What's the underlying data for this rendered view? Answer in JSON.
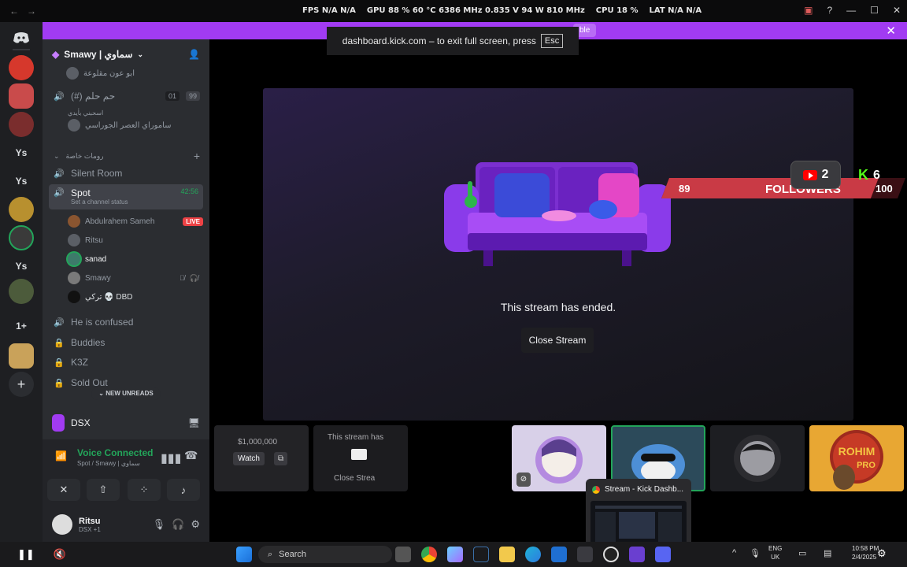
{
  "overlay_stats": {
    "fps": "FPS  N/A  N/A",
    "gpu": "GPU 88 % 60 °C 6386 MHz 0.835 V 94 W 810 MHz",
    "cpu": "CPU  18 %",
    "lat": "LAT  N/A  N/A"
  },
  "banner": {
    "pill_label": "ble",
    "close_icon": "close-icon"
  },
  "fullscreen_toast": {
    "text": "dashboard.kick.com – to exit full screen, press",
    "key": "Esc"
  },
  "rail": {
    "app_icon": "discord-logo-icon",
    "items": [
      "Ys",
      "Ys",
      "Ys",
      "1+"
    ],
    "add_label": "+"
  },
  "guild": {
    "name": "Smawy | سماوي"
  },
  "channels": {
    "top_item": "ابو عون مقلوعة",
    "voice_1": "(#) حم حلم",
    "voice_1_counts": [
      "01",
      "99"
    ],
    "voice_1_sub": "ساموراي العصر الجوراسي",
    "voice_1_sub2": "اسحبني بأيدي",
    "category": "رومات خاصة",
    "silent_room": "Silent Room",
    "spot": "Spot",
    "spot_time": "42:56",
    "spot_status": "Set a channel status",
    "members": [
      {
        "name": "Abdulrahem Sameh",
        "badge": "LIVE"
      },
      {
        "name": "Ritsu"
      },
      {
        "name": "sanad"
      },
      {
        "name": "Smawy"
      },
      {
        "name": "تركي 💀 DBD"
      }
    ],
    "he_is_confused": "He is confused",
    "buddies": "Buddies",
    "k3z": "K3Z",
    "sold_out": "Sold Out",
    "new_unreads": "NEW UNREADS"
  },
  "dsx": {
    "label": "DSX"
  },
  "voice": {
    "status": "Voice Connected",
    "sub": "Spot / Smawy | سماوي"
  },
  "user": {
    "name": "Ritsu",
    "sub": "DSX +1"
  },
  "stream": {
    "ended_text": "This stream has ended.",
    "close_button": "Close Stream",
    "followers": {
      "current": "89",
      "label": "FOLLOWERS",
      "goal": "100",
      "progress": 0.89
    },
    "youtube_count": "2",
    "kick_count": "6",
    "kick_letter": "K"
  },
  "tiles": {
    "tile1_text": "$1,000,000",
    "tile1_watch": "Watch",
    "tile2_text": "This stream has",
    "tile2_close": "Close Strea"
  },
  "preview": {
    "title": "Stream - Kick Dashb..."
  },
  "taskbar": {
    "search": "Search",
    "lang_top": "ENG",
    "lang_bottom": "UK",
    "clock_top": "10:58 PM",
    "clock_bottom": "2/4/2025"
  },
  "colors": {
    "brand_purple": "#a13bf2",
    "discord_green": "#23a55a",
    "live_red": "#ed4245"
  }
}
